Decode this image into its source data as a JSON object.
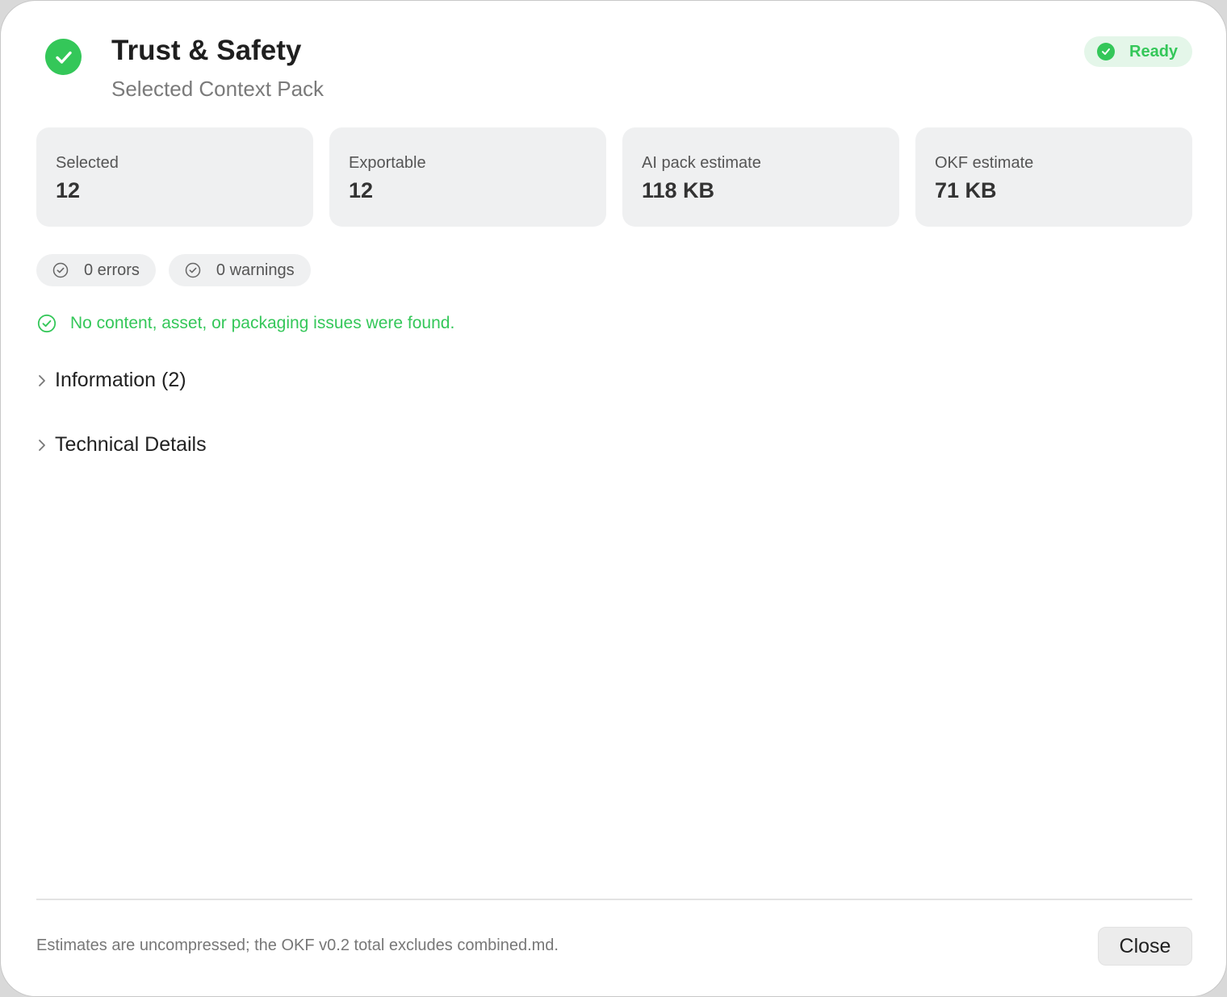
{
  "header": {
    "title": "Trust & Safety",
    "subtitle": "Selected Context Pack",
    "status": "Ready",
    "icon": "checkmark-circle-icon"
  },
  "stats": [
    {
      "label": "Selected",
      "value": "12"
    },
    {
      "label": "Exportable",
      "value": "12"
    },
    {
      "label": "AI pack estimate",
      "value": "118 KB"
    },
    {
      "label": "OKF estimate",
      "value": "71 KB"
    }
  ],
  "checks": {
    "errors": "0 errors",
    "warnings": "0 warnings"
  },
  "message": "No content, asset, or packaging issues were found.",
  "sections": {
    "information": "Information (2)",
    "technical": "Technical Details"
  },
  "footer": {
    "note": "Estimates are uncompressed; the OKF v0.2 total excludes combined.md.",
    "close_label": "Close"
  },
  "colors": {
    "success": "#34c759",
    "card_bg": "#eff0f1"
  }
}
